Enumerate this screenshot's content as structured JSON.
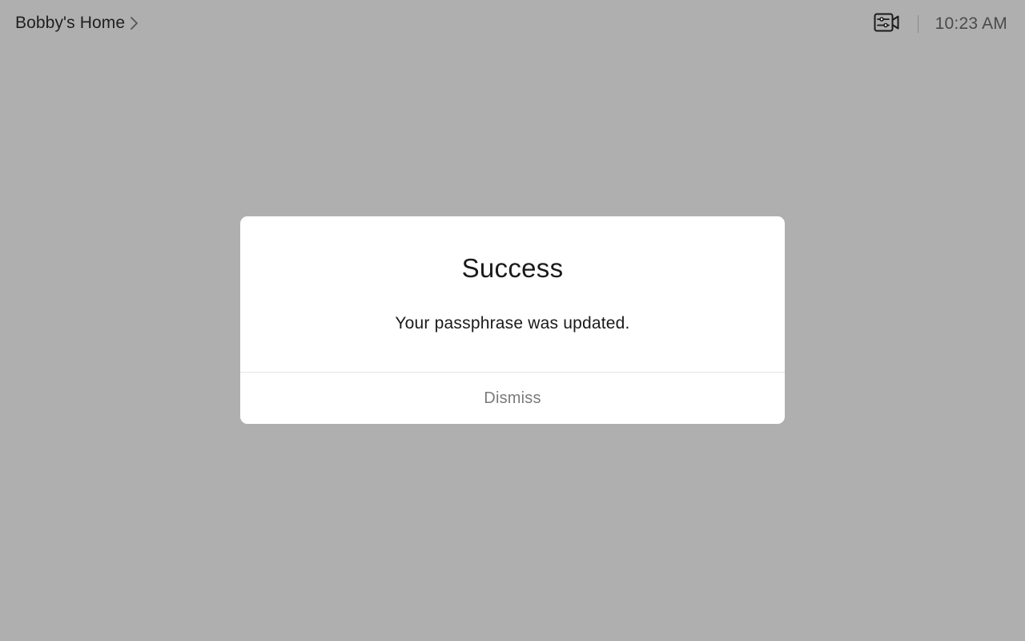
{
  "header": {
    "home_label": "Bobby's Home",
    "chevron_icon": "chevron-right-icon",
    "camera_controls_icon": "camera-controls-icon",
    "time": "10:23 AM"
  },
  "dialog": {
    "title": "Success",
    "message": "Your passphrase was updated.",
    "dismiss_label": "Dismiss"
  },
  "colors": {
    "backdrop": "#afafaf",
    "dialog_bg": "#ffffff",
    "dismiss_text": "#7a7a7a"
  }
}
